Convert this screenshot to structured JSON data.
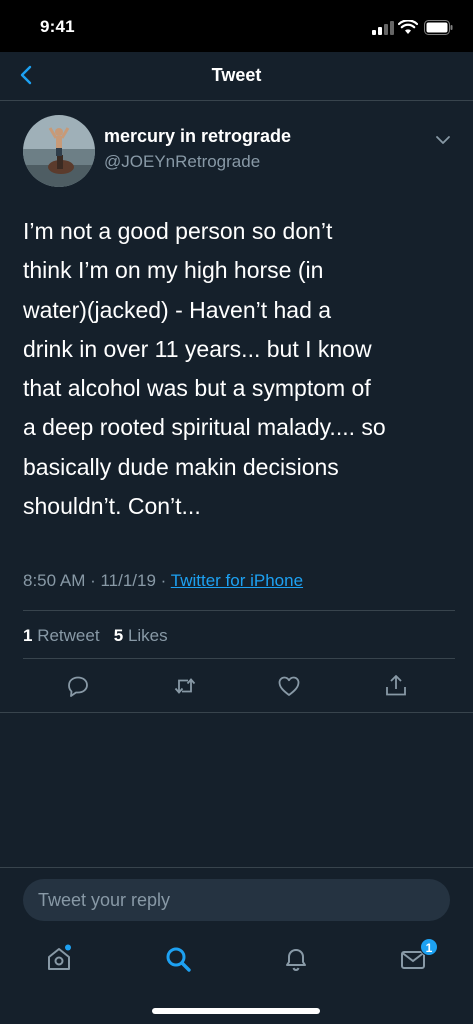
{
  "status_bar": {
    "time": "9:41"
  },
  "nav": {
    "title": "Tweet",
    "back_icon": "chevron-left-icon"
  },
  "tweet": {
    "display_name": "mercury in retrograde",
    "handle": "@JOEYnRetrograde",
    "text": "I’m not a good person so don’t\nthink I’m on my high horse (in\nwater)(jacked) - Haven’t had a\ndrink in over 11 years... but I know\nthat alcohol was but a symptom of\na deep rooted spiritual malady.... so\nbasically dude makin decisions\nshouldn’t. Con’t...",
    "time": "8:50 AM",
    "date": "11/1/19",
    "separator": " · ",
    "source": "Twitter for iPhone",
    "retweet_count": "1",
    "retweet_label": "Retweet",
    "like_count": "5",
    "like_label": "Likes"
  },
  "actions": [
    "reply-icon",
    "retweet-icon",
    "like-icon",
    "share-icon"
  ],
  "reply": {
    "placeholder": "Tweet your reply"
  },
  "tab_bar": {
    "items": [
      "home-icon",
      "search-icon",
      "notifications-icon",
      "messages-icon"
    ],
    "messages_badge": "1"
  },
  "colors": {
    "background": "#15202b",
    "accent": "#1da1f2",
    "secondary_text": "#8899a6",
    "divider": "#38444d"
  }
}
